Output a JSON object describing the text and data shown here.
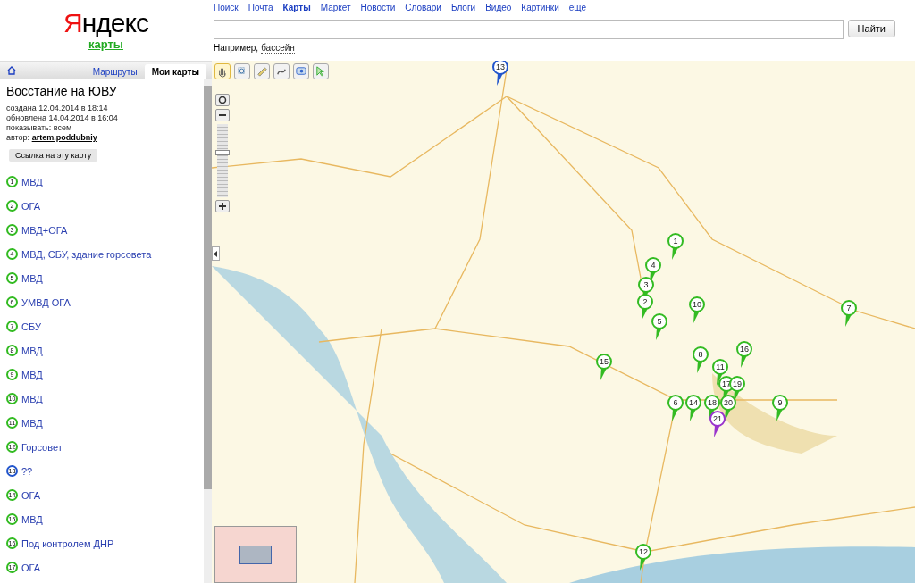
{
  "logo": {
    "brand": "Яндекс",
    "service": "карты"
  },
  "nav": [
    {
      "label": "Поиск",
      "selected": false
    },
    {
      "label": "Почта",
      "selected": false
    },
    {
      "label": "Карты",
      "selected": true
    },
    {
      "label": "Маркет",
      "selected": false
    },
    {
      "label": "Новости",
      "selected": false
    },
    {
      "label": "Словари",
      "selected": false
    },
    {
      "label": "Блоги",
      "selected": false
    },
    {
      "label": "Видео",
      "selected": false
    },
    {
      "label": "Картинки",
      "selected": false
    },
    {
      "label": "ещё",
      "selected": false
    }
  ],
  "search": {
    "button": "Найти",
    "example_prefix": "Например,",
    "example": "бассейн"
  },
  "tabs": [
    {
      "kind": "home",
      "selected": false
    },
    {
      "kind": "text",
      "label": "Маршруты",
      "selected": false
    },
    {
      "kind": "text",
      "label": "Мои карты",
      "selected": true
    }
  ],
  "map_info": {
    "title": "Восстание на ЮВУ",
    "created": "создана 12.04.2014 в 18:14",
    "updated": "обновлена 14.04.2014 в 16:04",
    "visibility": "показывать: всем",
    "author_label": "автор:",
    "author": "artem.poddubniy",
    "link_button": "Ссылка на эту карту"
  },
  "places": [
    {
      "number": "1",
      "name": "МВД",
      "color": "#33bb22"
    },
    {
      "number": "2",
      "name": "ОГА",
      "color": "#33bb22"
    },
    {
      "number": "3",
      "name": "МВД+ОГА",
      "color": "#33bb22"
    },
    {
      "number": "4",
      "name": "МВД, СБУ, здание горсовета",
      "color": "#33bb22"
    },
    {
      "number": "5",
      "name": "МВД",
      "color": "#33bb22"
    },
    {
      "number": "6",
      "name": "УМВД ОГА",
      "color": "#33bb22"
    },
    {
      "number": "7",
      "name": "СБУ",
      "color": "#33bb22"
    },
    {
      "number": "8",
      "name": "МВД",
      "color": "#33bb22"
    },
    {
      "number": "9",
      "name": "МВД",
      "color": "#33bb22"
    },
    {
      "number": "10",
      "name": "МВД",
      "color": "#33bb22"
    },
    {
      "number": "11",
      "name": "МВД",
      "color": "#33bb22"
    },
    {
      "number": "12",
      "name": "Горсовет",
      "color": "#33bb22"
    },
    {
      "number": "13",
      "name": "??",
      "color": "#2255cc"
    },
    {
      "number": "14",
      "name": "ОГА",
      "color": "#33bb22"
    },
    {
      "number": "15",
      "name": "МВД",
      "color": "#33bb22"
    },
    {
      "number": "16",
      "name": "Под контролем ДНР",
      "color": "#33bb22"
    },
    {
      "number": "17",
      "name": "ОГА",
      "color": "#33bb22"
    }
  ],
  "map": {
    "tools": [
      {
        "selected": true
      },
      {
        "selected": false
      },
      {
        "selected": false
      },
      {
        "selected": false
      },
      {
        "selected": false
      },
      {
        "selected": false
      }
    ],
    "zoom": {
      "level": 0.65
    },
    "pins": [
      {
        "number": "13",
        "color": "#2255cc"
      },
      {
        "number": "1",
        "color": "#33bb22"
      },
      {
        "number": "4",
        "color": "#33bb22"
      },
      {
        "number": "3",
        "color": "#33bb22"
      },
      {
        "number": "2",
        "color": "#33bb22"
      },
      {
        "number": "10",
        "color": "#33bb22"
      },
      {
        "number": "7",
        "color": "#33bb22"
      },
      {
        "number": "5",
        "color": "#33bb22"
      },
      {
        "number": "16",
        "color": "#33bb22"
      },
      {
        "number": "8",
        "color": "#33bb22"
      },
      {
        "number": "15",
        "color": "#33bb22"
      },
      {
        "number": "11",
        "color": "#33bb22"
      },
      {
        "number": "17",
        "color": "#33bb22"
      },
      {
        "number": "19",
        "color": "#33bb22"
      },
      {
        "number": "6",
        "color": "#33bb22"
      },
      {
        "number": "14",
        "color": "#33bb22"
      },
      {
        "number": "18",
        "color": "#33bb22"
      },
      {
        "number": "20",
        "color": "#33bb22"
      },
      {
        "number": "9",
        "color": "#33bb22"
      },
      {
        "number": "21",
        "color": "#9933cc"
      },
      {
        "number": "12",
        "color": "#33bb22"
      }
    ]
  }
}
